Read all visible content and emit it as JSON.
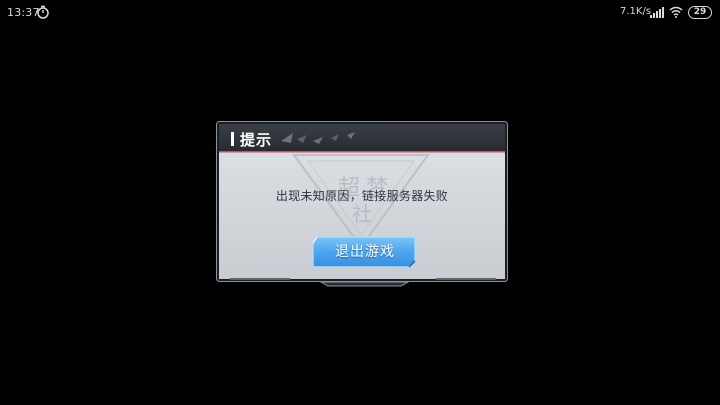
{
  "status_bar": {
    "time": "13:37",
    "timer_icon": "stopwatch-icon",
    "net_speed": "7.1K/s",
    "signal_icon": "cell-signal-icon",
    "wifi_icon": "wifi-icon",
    "battery_level": "29"
  },
  "dialog": {
    "title": "提示",
    "message": "出现未知原因，链接服务器失败",
    "button_label": "退出游戏",
    "watermark_text": [
      "超",
      "梦",
      "社"
    ],
    "colors": {
      "titlebar": "#2d3138",
      "accent_line": "#e0455a",
      "body": "#d3d7dc",
      "button": "#4aa6ee",
      "button_border": "#8fd3ff"
    }
  }
}
